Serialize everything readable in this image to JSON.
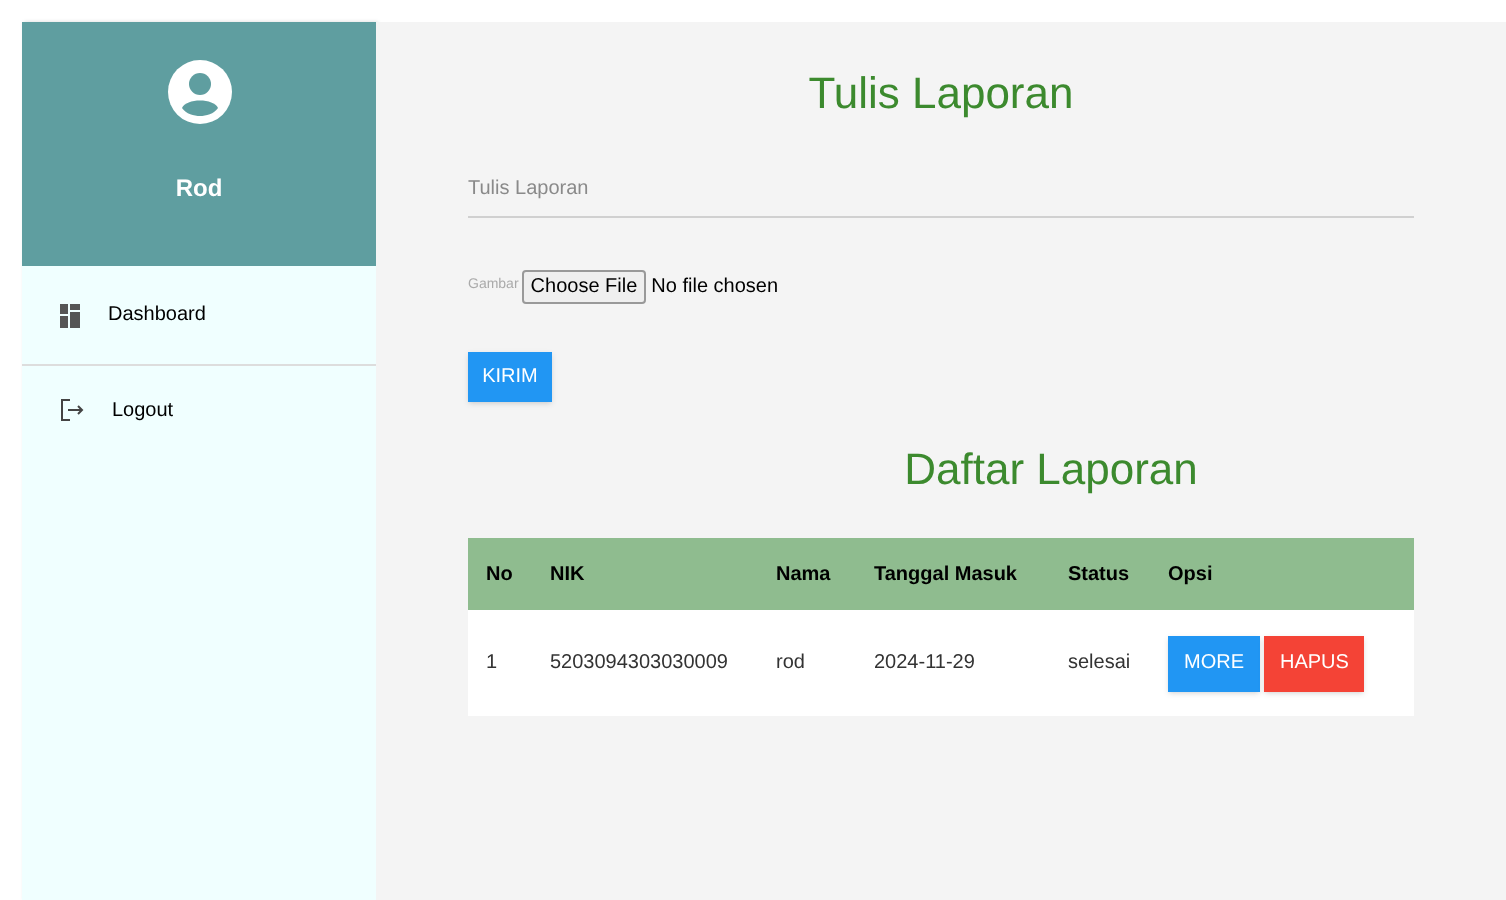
{
  "sidebar": {
    "user": "Rod",
    "items": [
      {
        "kind": "dashboard",
        "label": "Dashboard"
      },
      {
        "kind": "logout",
        "label": "Logout"
      }
    ]
  },
  "form": {
    "title": "Tulis Laporan",
    "placeholder": "Tulis Laporan",
    "file_label": "Gambar",
    "file_button": "Choose File",
    "file_status": "No file chosen",
    "submit": "KIRIM"
  },
  "table": {
    "title": "Daftar Laporan",
    "columns": [
      "No",
      "NIK",
      "Nama",
      "Tanggal Masuk",
      "Status",
      "Opsi"
    ],
    "rows": [
      {
        "cells": [
          "1",
          "5203094303030009",
          "rod",
          "2024-11-29",
          "selesai"
        ],
        "actions": [
          {
            "kind": "more",
            "label": "MORE"
          },
          {
            "kind": "delete",
            "label": "HAPUS"
          }
        ]
      }
    ]
  }
}
